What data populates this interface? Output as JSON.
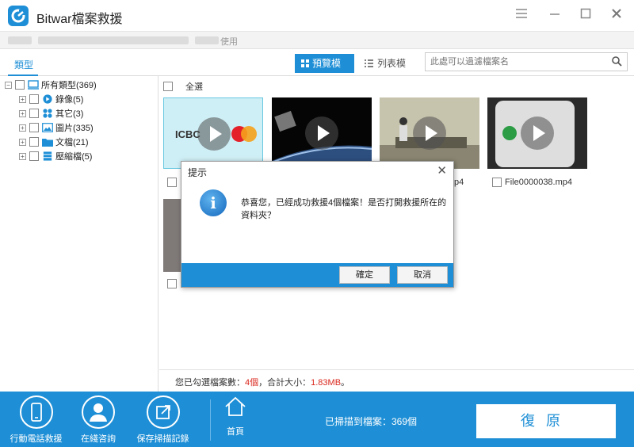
{
  "app": {
    "title": "Bitwar檔案救援",
    "usage_text": "使用"
  },
  "colors": {
    "accent": "#1e8fd6",
    "highlight_red": "#d9261c"
  },
  "window_controls": {
    "menu_icon": "menu-icon",
    "minimize_icon": "minimize-icon",
    "maximize_icon": "maximize-icon",
    "close_icon": "close-icon"
  },
  "toolbar": {
    "type_tab": "類型",
    "thumbnail_view": "預覽模式",
    "list_view": "列表模式",
    "search_placeholder": "此處可以過濾檔案名"
  },
  "tree": {
    "root": "所有類型(369)",
    "items": [
      {
        "label": "錄像(5)",
        "icon": "video-icon"
      },
      {
        "label": "其它(3)",
        "icon": "other-icon"
      },
      {
        "label": "圖片(335)",
        "icon": "picture-icon"
      },
      {
        "label": "文檔(21)",
        "icon": "folder-icon"
      },
      {
        "label": "壓縮檔(5)",
        "icon": "archive-icon"
      }
    ]
  },
  "content": {
    "select_all": "全選",
    "files": [
      {
        "name": ""
      },
      {
        "name": ""
      },
      {
        "name": "p4"
      },
      {
        "name": "File0000038.mp4"
      }
    ],
    "thumb1_brand": "ICBC"
  },
  "status": {
    "prefix": "您已勾選檔案數：",
    "count": "4個",
    "middle": "，合計大小：",
    "size": "1.83MB",
    "suffix": "。"
  },
  "dialog": {
    "title": "提示",
    "message": "恭喜您，已經成功救援4個檔案！是否打開救援所在的資料夾？",
    "ok": "確定",
    "cancel": "取消"
  },
  "bottom": {
    "phone": "行動電話救援",
    "online": "在綫咨詢",
    "save_scan": "保存掃描記錄",
    "home": "首頁",
    "scanned": "已掃描到檔案：369個",
    "recover": "復原"
  }
}
